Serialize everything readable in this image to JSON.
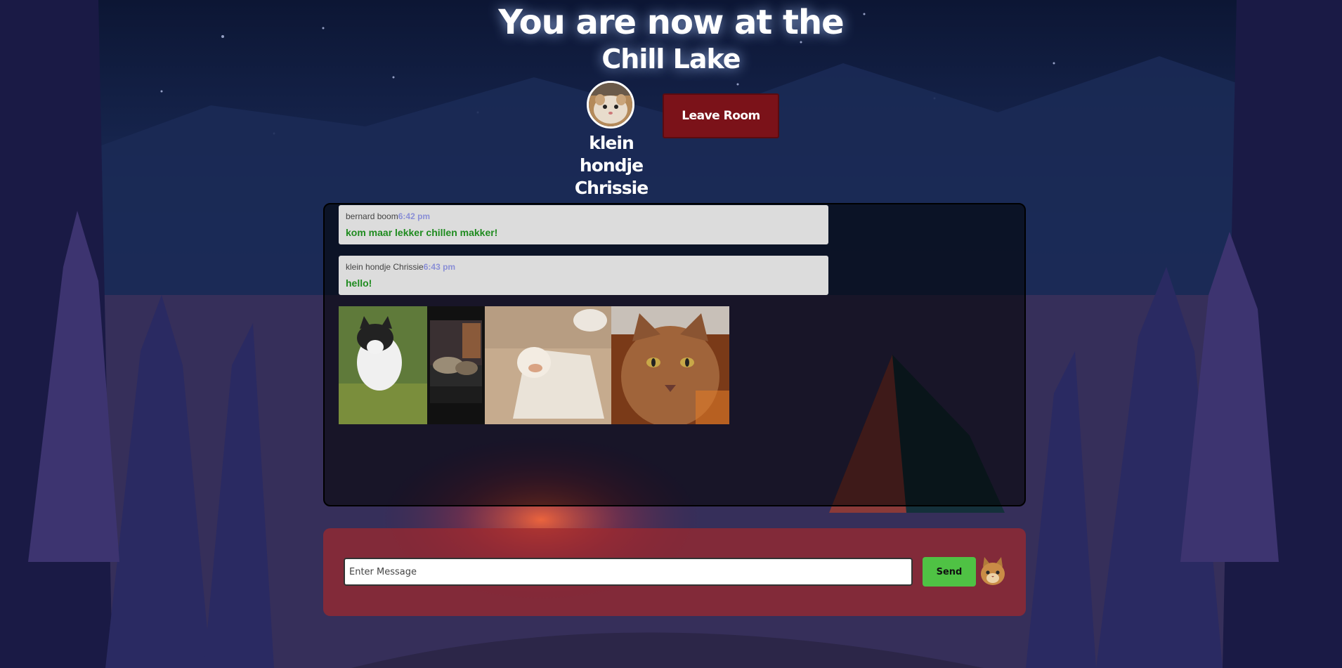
{
  "header": {
    "title_line1": "You are now at the",
    "title_line2": "Chill Lake"
  },
  "user": {
    "name_line1": "klein hondje",
    "name_line2": "Chrissie"
  },
  "leave_button": "Leave Room",
  "messages": [
    {
      "author": "bernard boom",
      "time": "6:42 pm",
      "text": "kom maar lekker chillen makker!"
    },
    {
      "author": "klein hondje Chrissie",
      "time": "6:43 pm",
      "text": "hello!"
    }
  ],
  "composer": {
    "placeholder": "Enter Message",
    "send_label": "Send"
  },
  "colors": {
    "leave_button": "#7b1219",
    "send_button": "#4fc244",
    "message_text": "#1f8b1f",
    "timestamp": "#8a8fd6",
    "composer_panel": "#a0282d"
  }
}
